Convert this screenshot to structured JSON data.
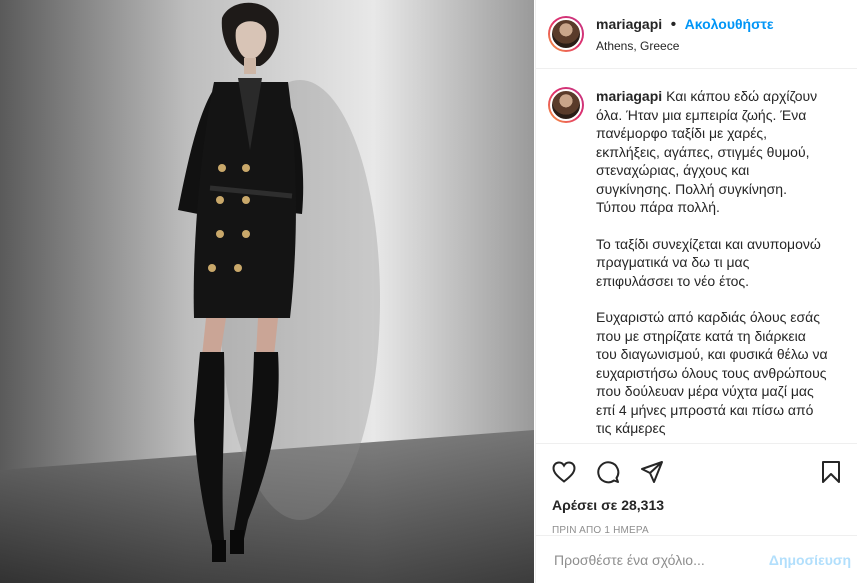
{
  "header": {
    "username": "mariagapi",
    "separator": "•",
    "follow_label": "Ακολουθήστε",
    "location": "Athens, Greece"
  },
  "caption": {
    "username": "mariagapi",
    "paragraphs": [
      "Και κάπου εδώ αρχίζουν όλα. Ήταν μια εμπειρία ζωής. Ένα πανέμορφο ταξίδι με χαρές, εκπλήξεις, αγάπες, στιγμές θυμού, στεναχώριας, άγχους και συγκίνησης. Πολλή συγκίνηση. Τύπου πάρα πολλή.",
      "Το ταξίδι συνεχίζεται και ανυπομονώ πραγματικά να δω τι μας επιφυλάσσει το νέο έτος.",
      "Ευχαριστώ από καρδιάς όλους εσάς που με στηρίζατε κατά τη διάρκεια του διαγωνισμού, και φυσικά θέλω να ευχαριστήσω όλους τους ανθρώπους που δούλευαν μέρα νύχτα μαζί μας επί 4 μήνες μπροστά και πίσω από τις κάμερες"
    ]
  },
  "actions": {
    "like_icon": "heart-icon",
    "comment_icon": "comment-icon",
    "share_icon": "share-icon",
    "save_icon": "bookmark-icon"
  },
  "likes_text": "Αρέσει σε 28,313",
  "timestamp": "ΠΡΙΝ ΑΠΟ 1 ΗΜΕΡΑ",
  "composer": {
    "placeholder": "Προσθέστε ένα σχόλιο...",
    "publish_label": "Δημοσίευση"
  },
  "colors": {
    "accent": "#0095f6",
    "publish_disabled": "#b2dffc",
    "muted": "#8e8e8e"
  }
}
